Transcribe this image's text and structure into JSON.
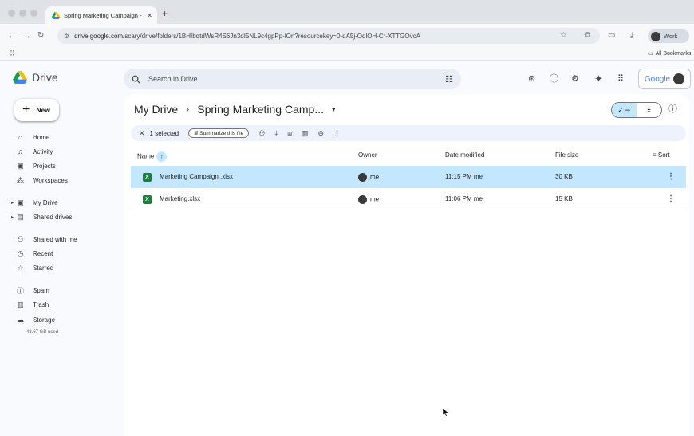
{
  "browser": {
    "tab_title": "Spring Marketing Campaign -",
    "url_host": "drive.google.com",
    "url_rest": "/scary/drive/folders/1BHIbqtdWsR4S6Jn3dI5NL9c4gpPp-lOn?resourcekey=0-qA5j-OdlOH-Cr-XTTGOvcA",
    "profile_label": "Work",
    "bookmarks_label": "All Bookmarks"
  },
  "app": {
    "name": "Drive",
    "search_placeholder": "Search in Drive",
    "google_label": "Google"
  },
  "sidebar": {
    "new_label": "New",
    "items": [
      {
        "label": "Home",
        "icon": "home-icon"
      },
      {
        "label": "Activity",
        "icon": "bell-icon"
      },
      {
        "label": "Projects",
        "icon": "projects-icon"
      },
      {
        "label": "Workspaces",
        "icon": "workspaces-icon"
      },
      {
        "label": "My Drive",
        "icon": "my-drive-icon"
      },
      {
        "label": "Shared drives",
        "icon": "shared-drives-icon"
      },
      {
        "label": "Shared with me",
        "icon": "people-icon"
      },
      {
        "label": "Recent",
        "icon": "clock-icon"
      },
      {
        "label": "Starred",
        "icon": "star-icon"
      },
      {
        "label": "Spam",
        "icon": "spam-icon"
      },
      {
        "label": "Trash",
        "icon": "trash-icon"
      },
      {
        "label": "Storage",
        "icon": "cloud-icon"
      }
    ],
    "storage_used": "48.67 GB used"
  },
  "main": {
    "breadcrumb_root": "My Drive",
    "breadcrumb_current": "Spring Marketing Camp...",
    "selection_count": "1 selected",
    "summarize_label": "Summarize this file",
    "columns": {
      "name": "Name",
      "owner": "Owner",
      "date": "Date modified",
      "size": "File size",
      "sort": "Sort"
    },
    "files": [
      {
        "name": "Marketing Campaign .xlsx",
        "owner": "me",
        "date": "11:15 PM me",
        "size": "30 KB",
        "selected": true
      },
      {
        "name": "Marketing.xlsx",
        "owner": "me",
        "date": "11:06 PM me",
        "size": "15 KB",
        "selected": false
      }
    ]
  },
  "colors": {
    "selected_row": "#c2e7ff",
    "accent": "#0b57d0",
    "excel_green": "#188038"
  }
}
